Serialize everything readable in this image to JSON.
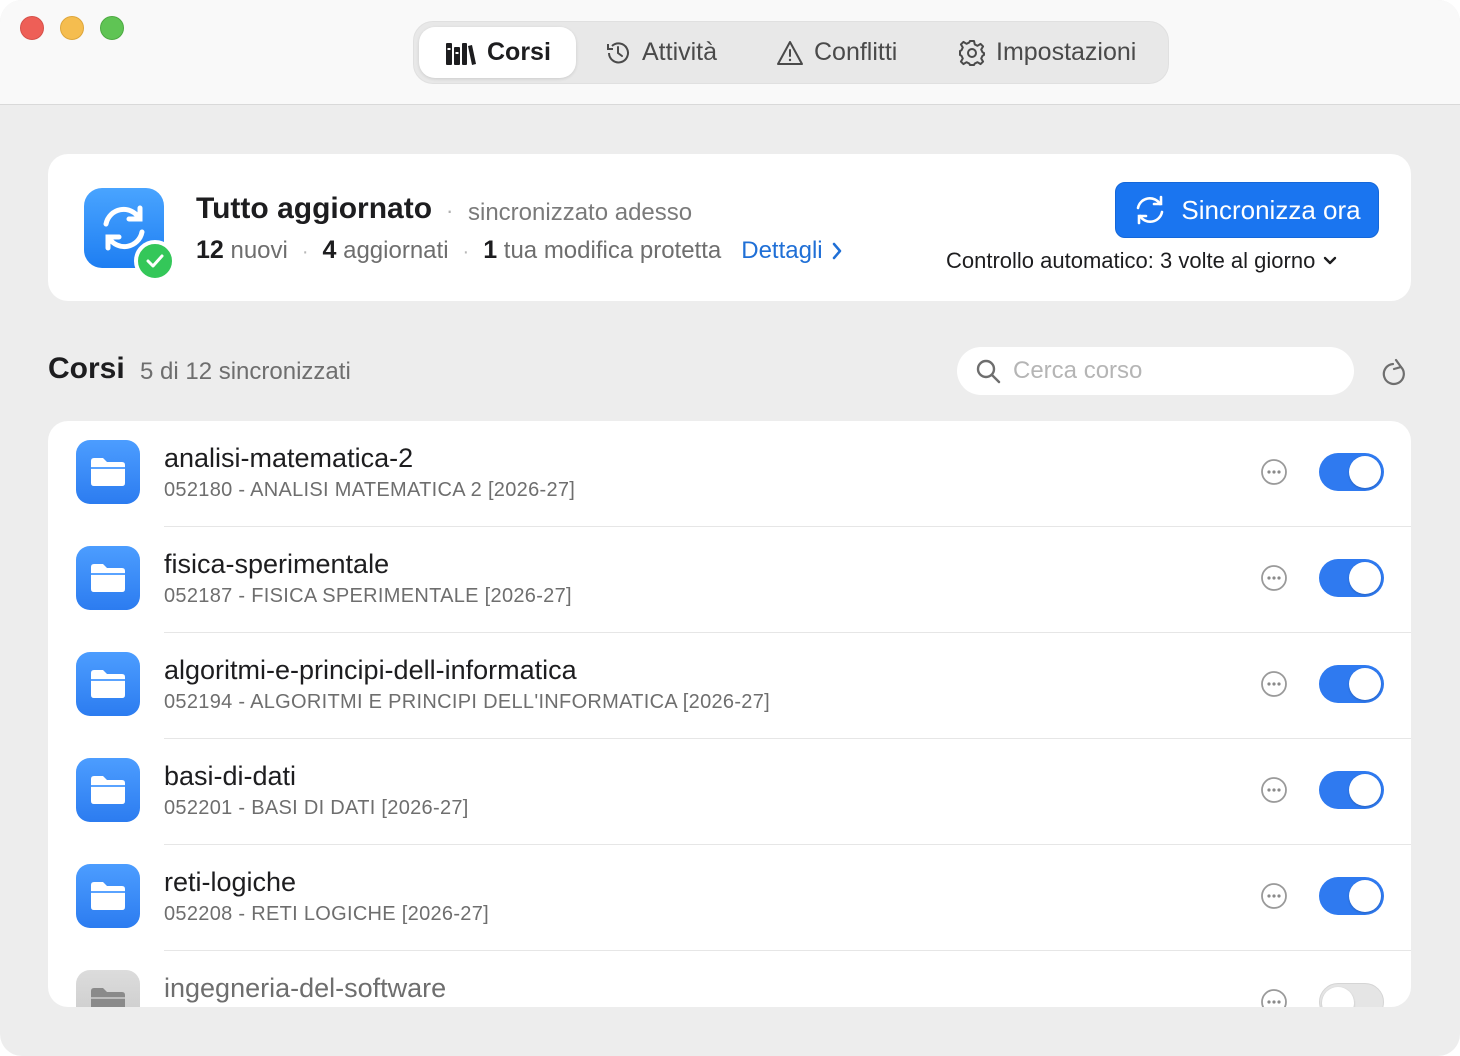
{
  "tabs": [
    {
      "label": "Corsi",
      "icon": "books-icon",
      "active": true
    },
    {
      "label": "Attività",
      "icon": "history-icon",
      "active": false
    },
    {
      "label": "Conflitti",
      "icon": "warning-icon",
      "active": false
    },
    {
      "label": "Impostazioni",
      "icon": "gear-icon",
      "active": false
    }
  ],
  "status": {
    "title": "Tutto aggiornato",
    "separator": "·",
    "subtitle": "sincronizzato adesso",
    "new_count": "12",
    "new_label": "nuovi",
    "updated_count": "4",
    "updated_label": "aggiornati",
    "protected_count": "1",
    "protected_label": "tua modifica protetta",
    "details_link": "Dettagli",
    "sync_button": "Sincronizza ora",
    "auto_check": "Controllo automatico: 3 volte al giorno"
  },
  "section": {
    "title": "Corsi",
    "subtitle": "5 di 12 sincronizzati",
    "search_placeholder": "Cerca corso"
  },
  "courses": [
    {
      "name": "analisi-matematica-2",
      "code": "052180 - ANALISI MATEMATICA 2 [2026-27]",
      "enabled": true
    },
    {
      "name": "fisica-sperimentale",
      "code": "052187 - FISICA SPERIMENTALE [2026-27]",
      "enabled": true
    },
    {
      "name": "algoritmi-e-principi-dell-informatica",
      "code": "052194 - ALGORITMI E PRINCIPI DELL'INFORMATICA [2026-27]",
      "enabled": true
    },
    {
      "name": "basi-di-dati",
      "code": "052201 - BASI DI DATI [2026-27]",
      "enabled": true
    },
    {
      "name": "reti-logiche",
      "code": "052208 - RETI LOGICHE [2026-27]",
      "enabled": true
    },
    {
      "name": "ingegneria-del-software",
      "code": "",
      "enabled": false
    }
  ],
  "colors": {
    "accent": "#1a75f0",
    "success": "#34c759",
    "link": "#1f6fd6"
  }
}
